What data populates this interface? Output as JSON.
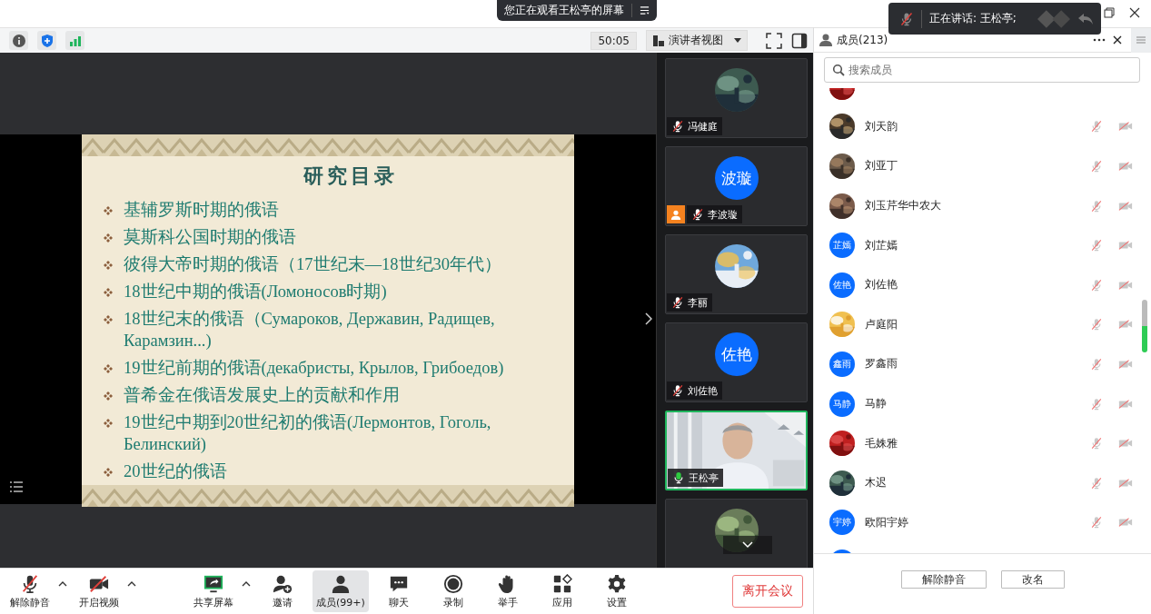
{
  "share_banner": {
    "text": "您正在观看王松亭的屏幕"
  },
  "speaking_toast": {
    "text": "正在讲话: 王松亭;"
  },
  "toolbar": {
    "timer": "50:05",
    "view_button": "演讲者视图"
  },
  "slide": {
    "title": "研究目录",
    "items": [
      "基辅罗斯时期的俄语",
      "莫斯科公国时期的俄语",
      "彼得大帝时期的俄语（17世纪末—18世纪30年代）",
      "18世纪中期的俄语(Ломоносов时期)",
      "18世纪末的俄语（Сумароков, Державин, Радищев,\nКарамзин...)",
      "19世纪前期的俄语(декабристы, Крылов, Грибоедов)",
      "普希金在俄语发展史上的贡献和作用",
      "19世纪中期到20世纪初的俄语(Лермонтов, Гоголь,\nБелинский)",
      "20世纪的俄语"
    ]
  },
  "video_tiles": [
    {
      "kind": "avatar",
      "name": "冯健庭",
      "mic_on": false,
      "host": false,
      "speaking": false
    },
    {
      "kind": "avatar",
      "name": "李波璇",
      "avatar": {
        "kind": "initials",
        "text": "波璇"
      },
      "mic_on": false,
      "host": true,
      "speaking": false
    },
    {
      "kind": "avatar",
      "name": "李丽",
      "mic_on": false,
      "host": false,
      "speaking": false
    },
    {
      "kind": "avatar",
      "name": "刘佐艳",
      "avatar": {
        "kind": "initials",
        "text": "佐艳"
      },
      "mic_on": false,
      "host": false,
      "speaking": false
    },
    {
      "kind": "video",
      "name": "王松亭",
      "mic_on": true,
      "host": false,
      "speaking": true
    },
    {
      "kind": "partial"
    }
  ],
  "members_panel": {
    "title": "成员(213)",
    "search": {
      "placeholder": "搜索成员"
    },
    "members": [
      {
        "kind": "partial"
      },
      {
        "kind": "member",
        "name": "刘天韵",
        "mic_muted": true,
        "camera_off": true
      },
      {
        "kind": "member",
        "name": "刘亚丁",
        "mic_muted": true,
        "camera_off": true
      },
      {
        "kind": "member",
        "name": "刘玉芹华中农大",
        "mic_muted": true,
        "camera_off": true
      },
      {
        "kind": "member",
        "name": "刘芷嫣",
        "avatar": {
          "kind": "initials",
          "text": "芷嫣"
        },
        "mic_muted": true,
        "camera_off": true
      },
      {
        "kind": "member",
        "name": "刘佐艳",
        "avatar": {
          "kind": "initials",
          "text": "佐艳"
        },
        "mic_muted": true,
        "camera_off": true
      },
      {
        "kind": "member",
        "name": "卢庭阳",
        "mic_muted": true,
        "camera_off": true
      },
      {
        "kind": "member",
        "name": "罗鑫雨",
        "avatar": {
          "kind": "initials",
          "text": "鑫雨"
        },
        "mic_muted": true,
        "camera_off": true
      },
      {
        "kind": "member",
        "name": "马静",
        "avatar": {
          "kind": "initials",
          "text": "马静"
        },
        "mic_muted": true,
        "camera_off": true
      },
      {
        "kind": "member",
        "name": "毛姝雅",
        "mic_muted": true,
        "camera_off": true
      },
      {
        "kind": "member",
        "name": "木迟",
        "mic_muted": true,
        "camera_off": true
      },
      {
        "kind": "member",
        "name": "欧阳宇婷",
        "avatar": {
          "kind": "initials",
          "text": "宇婷"
        },
        "mic_muted": true,
        "camera_off": true
      },
      {
        "kind": "partial",
        "avatar": {
          "kind": "initials"
        }
      }
    ],
    "buttons": [
      "解除静音",
      "改名"
    ]
  },
  "bottom_toolbar": {
    "tools": [
      {
        "kind": "mic-muted",
        "label": "解除静音",
        "menu": true,
        "selected": false
      },
      {
        "kind": "camera-off",
        "label": "开启视频",
        "menu": true,
        "selected": false
      },
      {
        "kind": "share",
        "label": "共享屏幕",
        "menu": true,
        "selected": false
      },
      {
        "kind": "invite",
        "label": "邀请",
        "menu": false,
        "selected": false
      },
      {
        "kind": "members",
        "label": "成员(99+)",
        "menu": false,
        "selected": true
      },
      {
        "kind": "chat",
        "label": "聊天",
        "menu": false,
        "selected": false
      },
      {
        "kind": "record",
        "label": "录制",
        "menu": false,
        "selected": false
      },
      {
        "kind": "hand",
        "label": "举手",
        "menu": false,
        "selected": false
      },
      {
        "kind": "apps",
        "label": "应用",
        "menu": false,
        "selected": false
      },
      {
        "kind": "settings",
        "label": "设置",
        "menu": false,
        "selected": false
      }
    ],
    "leave_button": "离开会议"
  }
}
